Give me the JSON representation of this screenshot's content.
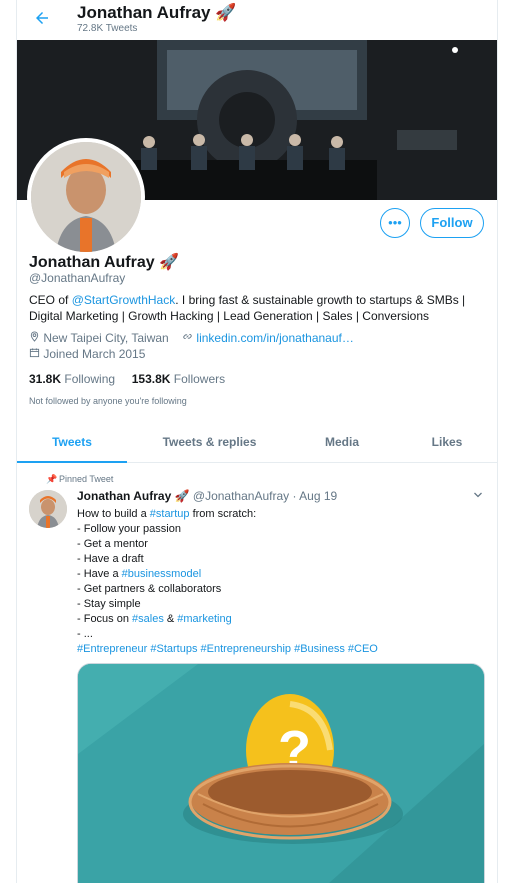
{
  "header": {
    "name": "Jonathan Aufray",
    "emoji": "🚀",
    "tweet_count": "72.8K Tweets"
  },
  "profile": {
    "name": "Jonathan Aufray",
    "emoji": "🚀",
    "handle": "@JonathanAufray",
    "bio_prefix": "CEO of ",
    "bio_mention": "@StartGrowthHack",
    "bio_suffix": ". I bring fast & sustainable growth to startups & SMBs | Digital Marketing | Growth Hacking | Lead Generation | Sales | Conversions",
    "location": "New Taipei City, Taiwan",
    "website": "linkedin.com/in/jonathanauf…",
    "joined": "Joined March 2015",
    "following_count": "31.8K",
    "following_label": "Following",
    "followers_count": "153.8K",
    "followers_label": "Followers",
    "not_followed": "Not followed by anyone you're following",
    "follow_label": "Follow",
    "more_label": "•••"
  },
  "tabs": [
    {
      "label": "Tweets"
    },
    {
      "label": "Tweets & replies"
    },
    {
      "label": "Media"
    },
    {
      "label": "Likes"
    }
  ],
  "tweet": {
    "pinned_label": "Pinned Tweet",
    "name": "Jonathan Aufray",
    "emoji": "🚀",
    "handle": "@JonathanAufray",
    "sep": "·",
    "date": "Aug 19",
    "line1_prefix": "How to build a ",
    "line1_tag": "#startup",
    "line1_suffix": " from scratch:",
    "line2": "- Follow your passion",
    "line3": "- Get a mentor",
    "line4": "- Have a draft",
    "line5_prefix": "- Have a ",
    "line5_tag": "#businessmodel",
    "line6": "- Get partners & collaborators",
    "line7": "- Stay simple",
    "line8_prefix": "- Focus on ",
    "line8_tag1": "#sales",
    "line8_amp": " & ",
    "line8_tag2": "#marketing",
    "line9": "- ...",
    "hashtags": "#Entrepreneur #Startups #Entrepreneurship #Business #CEO"
  },
  "colors": {
    "accent": "#1da1f2",
    "link": "#1b95e0",
    "muted": "#657786",
    "border": "#e6ecf0"
  }
}
